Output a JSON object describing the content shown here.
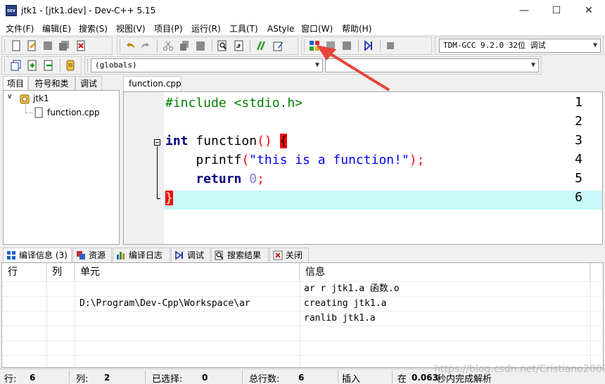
{
  "window": {
    "title": "jtk1 - [jtk1.dev] - Dev-C++ 5.15",
    "app_icon_text": "DEV",
    "minimize": "—",
    "maximize": "☐",
    "close": "✕"
  },
  "menu": [
    "文件(F)",
    "编辑(E)",
    "搜索(S)",
    "视图(V)",
    "项目(P)",
    "运行(R)",
    "工具(T)",
    "AStyle",
    "窗口(W)",
    "帮助(H)"
  ],
  "toolbar": {
    "compiler_select": "TDM-GCC 9.2.0 32位  调试",
    "scope_select": "(globals)",
    "member_select": ""
  },
  "left_panel": {
    "tabs": [
      "项目",
      "符号和类",
      "调试"
    ],
    "active_tab": "项目",
    "tree": {
      "project": "jtk1",
      "files": [
        "function.cpp"
      ]
    }
  },
  "editor": {
    "tab": "function.cpp",
    "line_numbers": [
      "1",
      "2",
      "3",
      "4",
      "5",
      "6"
    ],
    "lines": {
      "l1": "#include <stdio.h>",
      "l3_kw": "int",
      "l3_fn": " function",
      "l3_paren": "()",
      "l3_brace": "{",
      "l4_fn": "    printf",
      "l4_p1": "(",
      "l4_str": "\"this is a function!\"",
      "l4_p2": ")",
      "l4_semi": ";",
      "l5_kw": "    return",
      "l5_num": " 0",
      "l5_semi": ";",
      "l6_brace": "}"
    },
    "colors": {
      "keyword": "#000080",
      "preprocessor": "#008000",
      "string": "#0000ff",
      "number": "#8080c0",
      "symbol": "#ff0000",
      "current_line": "#c8f8f8",
      "brace_match_bg": "#ff0000"
    }
  },
  "bottom": {
    "tabs": [
      {
        "label": "编译信息 (3)",
        "icon": "grid-icon"
      },
      {
        "label": "资源",
        "icon": "resources-icon"
      },
      {
        "label": "编译日志",
        "icon": "chart-icon"
      },
      {
        "label": "调试",
        "icon": "debug-icon"
      },
      {
        "label": "搜索结果",
        "icon": "search-icon"
      },
      {
        "label": "关闭",
        "icon": "close-icon"
      }
    ],
    "columns": [
      "行",
      "列",
      "单元",
      "信息"
    ],
    "rows": [
      {
        "row": "",
        "col": "",
        "unit": "",
        "info": "ar r jtk1.a 函数.o"
      },
      {
        "row": "",
        "col": "",
        "unit": "D:\\Program\\Dev-Cpp\\Workspace\\ar",
        "info": "creating jtk1.a"
      },
      {
        "row": "",
        "col": "",
        "unit": "",
        "info": "ranlib jtk1.a"
      }
    ]
  },
  "status": {
    "row_label": "行:",
    "row_value": "6",
    "col_label": "列:",
    "col_value": "2",
    "sel_label": "已选择:",
    "sel_value": "0",
    "total_label": "总行数:",
    "total_value": "6",
    "mode": "插入",
    "parse_prefix": "在",
    "parse_time": "0.063",
    "parse_suffix": "秒内完成解析"
  },
  "watermark": "https://blog.csdn.net/Cristiano2000"
}
